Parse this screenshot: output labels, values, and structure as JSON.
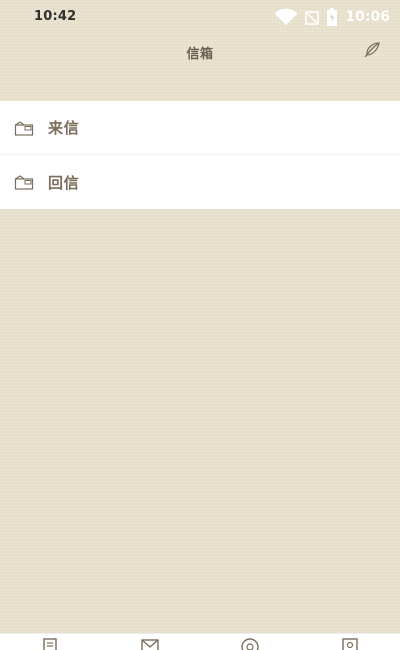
{
  "status_bar": {
    "time": "10:42",
    "right_text": "10:06",
    "icons": [
      "wifi-icon",
      "signal-off-icon",
      "battery-icon",
      "signal-icon"
    ]
  },
  "header": {
    "title": "信箱",
    "compose_icon": "feather-icon"
  },
  "mail_list": {
    "items": [
      {
        "label": "来信",
        "icon": "inbox-icon"
      },
      {
        "label": "回信",
        "icon": "reply-icon"
      }
    ]
  },
  "bottom_nav": {
    "items": [
      {
        "icon": "document-icon"
      },
      {
        "icon": "mail-icon"
      },
      {
        "icon": "compass-icon"
      },
      {
        "icon": "profile-icon"
      }
    ]
  },
  "colors": {
    "background": "#e8e1cc",
    "title": "#6a5e4e",
    "label": "#7a6d5c",
    "list_bg": "#ffffff"
  }
}
